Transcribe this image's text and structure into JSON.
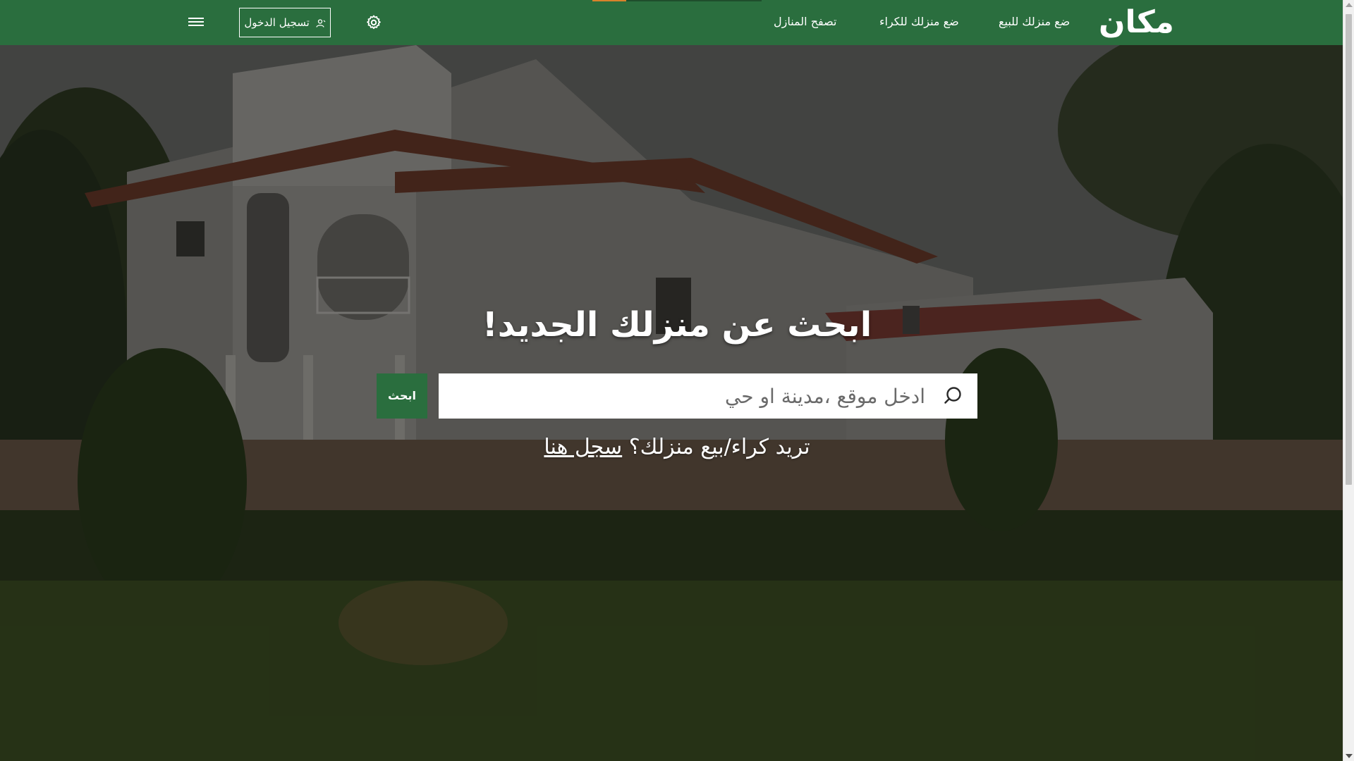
{
  "header": {
    "logo": "مكان",
    "nav": [
      {
        "label": "ضع منزلك للبيع"
      },
      {
        "label": "ضع منزلك للكراء"
      },
      {
        "label": "تصفح المنازل"
      }
    ],
    "login_label": "تسجيل الدخول",
    "settings_icon": "gear-icon",
    "menu_icon": "hamburger-menu-icon",
    "user_icon": "user-icon",
    "brand_color": "#2a6e3e",
    "accent_color": "#d9822b"
  },
  "hero": {
    "title": "ابحث عن منزلك الجديد!",
    "search": {
      "placeholder": "ادخل موقع ،مدينة او حي",
      "value": "",
      "icon": "search-icon",
      "button_label": "ابحث"
    },
    "register_prompt": "تريد كراء/بيع منزلك؟",
    "register_link": "سجل هنا"
  }
}
